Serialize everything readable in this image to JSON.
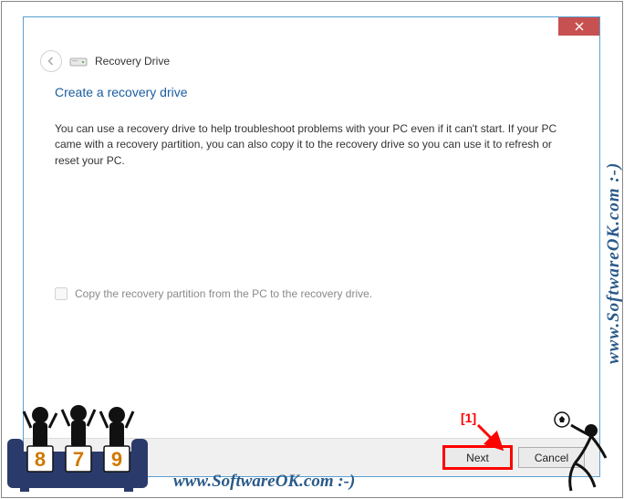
{
  "window": {
    "wizard_title": "Recovery Drive"
  },
  "content": {
    "heading": "Create a recovery drive",
    "body": "You can use a recovery drive to help troubleshoot problems with your PC even if it can't start. If your PC came with a recovery partition, you can also copy it to the recovery drive so you can use it to refresh or reset your PC.",
    "checkbox_label": "Copy the recovery partition from the PC to the recovery drive."
  },
  "buttons": {
    "next": "Next",
    "cancel": "Cancel"
  },
  "annotation": {
    "label": "[1]"
  },
  "watermarks": {
    "side": "www.SoftwareOK.com :-)",
    "bottom": "www.SoftwareOK.com :-)"
  },
  "judges": {
    "scores": [
      "8",
      "7",
      "9"
    ]
  }
}
